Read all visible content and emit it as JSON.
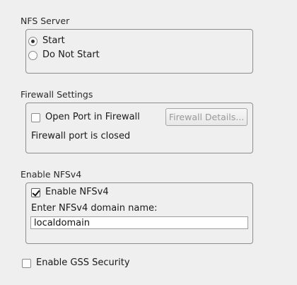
{
  "nfs_server": {
    "title": "NFS Server",
    "options": [
      {
        "label": "Start",
        "selected": true
      },
      {
        "label": "Do Not Start",
        "selected": false
      }
    ]
  },
  "firewall": {
    "title": "Firewall Settings",
    "open_port_label": "Open Port in Firewall",
    "open_port_checked": false,
    "details_button_label": "Firewall Details...",
    "details_button_enabled": false,
    "status_text": "Firewall port is closed"
  },
  "nfsv4": {
    "title": "Enable NFSv4",
    "enable_label": "Enable NFSv4",
    "enable_checked": true,
    "domain_label": "Enter NFSv4 domain name:",
    "domain_value": "localdomain"
  },
  "gss": {
    "label": "Enable GSS Security",
    "checked": false
  }
}
